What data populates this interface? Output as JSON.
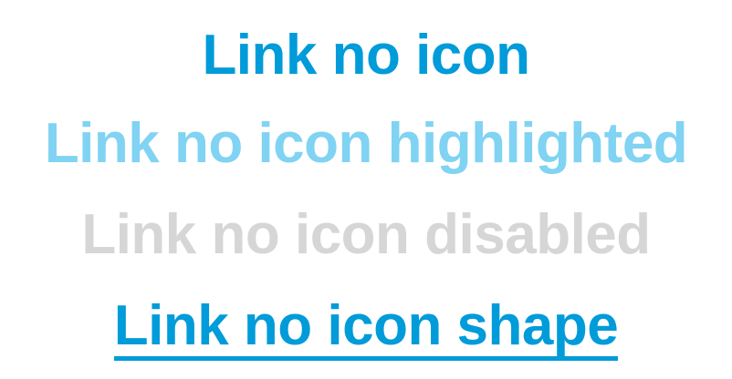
{
  "links": {
    "default": {
      "label": "Link no icon",
      "state": "default",
      "color": "#009bd9"
    },
    "highlighted": {
      "label": "Link no icon highlighted",
      "state": "highlighted",
      "color": "#80d3f2"
    },
    "disabled": {
      "label": "Link no icon disabled",
      "state": "disabled",
      "color": "#d6d6d6"
    },
    "shape": {
      "label": "Link no icon shape",
      "state": "shape (underlined)",
      "color": "#009bd9"
    }
  }
}
